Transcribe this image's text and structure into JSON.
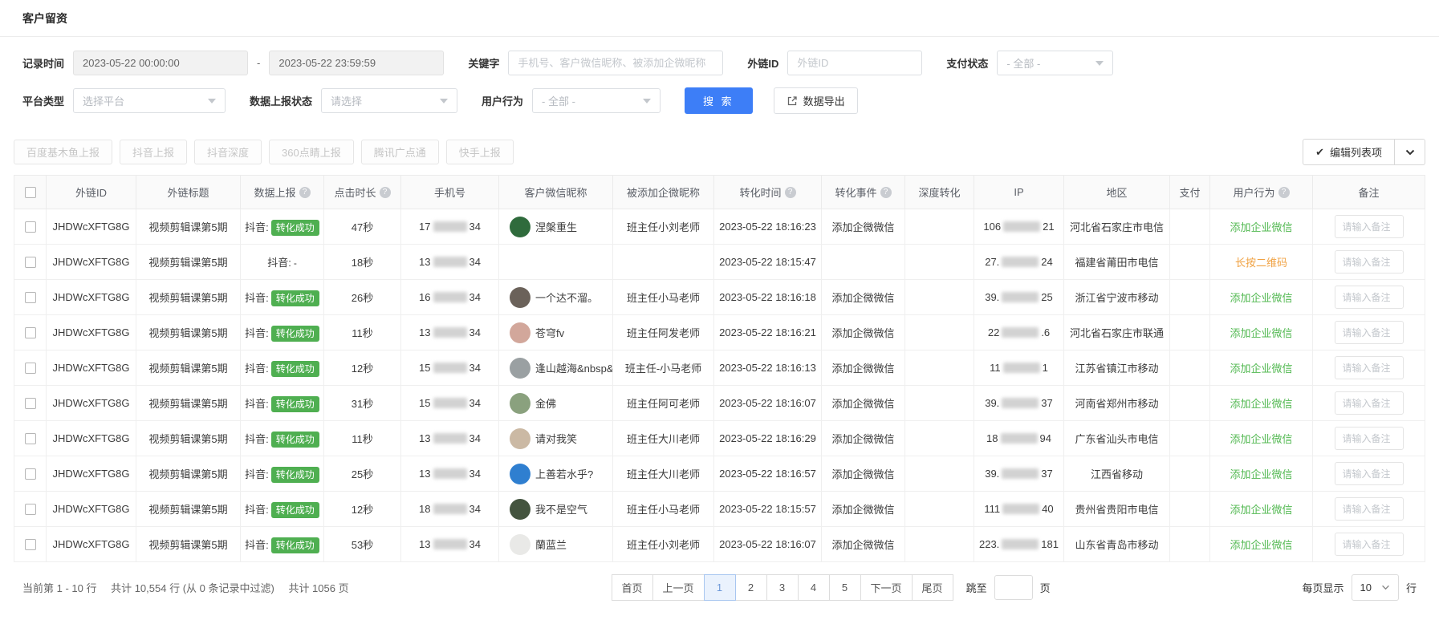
{
  "page": {
    "title": "客户留资"
  },
  "icons": {
    "help_glyph": "?",
    "check_glyph": "✔"
  },
  "colors": {
    "accent_blue": "#3d7ef7",
    "badge_green": "#4faf51",
    "link_green": "#53b952",
    "warn_orange": "#f0a243"
  },
  "filters": {
    "record_time": {
      "label": "记录时间",
      "from": "2023-05-22 00:00:00",
      "separator": "-",
      "to": "2023-05-22 23:59:59"
    },
    "keyword": {
      "label": "关键字",
      "placeholder": "手机号、客户微信昵称、被添加企微昵称"
    },
    "link_id": {
      "label": "外链ID",
      "placeholder": "外链ID"
    },
    "pay_status": {
      "label": "支付状态",
      "value": "- 全部 -"
    },
    "platform": {
      "label": "平台类型",
      "placeholder": "选择平台"
    },
    "report_state": {
      "label": "数据上报状态",
      "placeholder": "请选择"
    },
    "user_behavior": {
      "label": "用户行为",
      "value": "- 全部 -"
    },
    "search_label": "搜 索",
    "export_label": "数据导出"
  },
  "report_tabs": [
    "百度基木鱼上报",
    "抖音上报",
    "抖音深度",
    "360点睛上报",
    "腾讯广点通",
    "快手上报"
  ],
  "edit_columns": {
    "label": "编辑列表项"
  },
  "table": {
    "note_placeholder": "请输入备注",
    "headers": [
      {
        "label": "外链ID",
        "help": false
      },
      {
        "label": "外链标题",
        "help": false
      },
      {
        "label": "数据上报",
        "help": true
      },
      {
        "label": "点击时长",
        "help": true
      },
      {
        "label": "手机号",
        "help": false
      },
      {
        "label": "客户微信昵称",
        "help": false
      },
      {
        "label": "被添加企微昵称",
        "help": false
      },
      {
        "label": "转化时间",
        "help": true
      },
      {
        "label": "转化事件",
        "help": true
      },
      {
        "label": "深度转化",
        "help": false
      },
      {
        "label": "IP",
        "help": false
      },
      {
        "label": "地区",
        "help": false
      },
      {
        "label": "支付",
        "help": false
      },
      {
        "label": "用户行为",
        "help": true
      },
      {
        "label": "备注",
        "help": false
      }
    ],
    "rows": [
      {
        "link_id": "JHDWcXFTG8G",
        "link_title": "视频剪辑课第5期",
        "report_prefix": "抖音:",
        "report_status": "转化成功",
        "report_success": true,
        "duration": "47秒",
        "phone_prefix": "17",
        "phone_suffix": "34",
        "avatar_color": "#2f6b3c",
        "nickname": "涅槃重生",
        "added_name": "班主任小刘老师",
        "convert_time": "2023-05-22 18:16:23",
        "convert_event": "添加企微微信",
        "deep_convert": "",
        "ip_prefix": "106",
        "ip_suffix": "21",
        "region": "河北省石家庄市电信",
        "pay": "",
        "behavior": "添加企业微信",
        "behavior_type": "green"
      },
      {
        "link_id": "JHDWcXFTG8G",
        "link_title": "视频剪辑课第5期",
        "report_prefix": "抖音:",
        "report_status": "-",
        "report_success": false,
        "duration": "18秒",
        "phone_prefix": "13",
        "phone_suffix": "34",
        "avatar_color": "",
        "nickname": "",
        "added_name": "",
        "convert_time": "2023-05-22 18:15:47",
        "convert_event": "",
        "deep_convert": "",
        "ip_prefix": "27.",
        "ip_suffix": "24",
        "region": "福建省莆田市电信",
        "pay": "",
        "behavior": "长按二维码",
        "behavior_type": "orange"
      },
      {
        "link_id": "JHDWcXFTG8G",
        "link_title": "视频剪辑课第5期",
        "report_prefix": "抖音:",
        "report_status": "转化成功",
        "report_success": true,
        "duration": "26秒",
        "phone_prefix": "16",
        "phone_suffix": "34",
        "avatar_color": "#6b625a",
        "nickname": "一个达不溜。",
        "added_name": "班主任小马老师",
        "convert_time": "2023-05-22 18:16:18",
        "convert_event": "添加企微微信",
        "deep_convert": "",
        "ip_prefix": "39.",
        "ip_suffix": "25",
        "region": "浙江省宁波市移动",
        "pay": "",
        "behavior": "添加企业微信",
        "behavior_type": "green"
      },
      {
        "link_id": "JHDWcXFTG8G",
        "link_title": "视频剪辑课第5期",
        "report_prefix": "抖音:",
        "report_status": "转化成功",
        "report_success": true,
        "duration": "11秒",
        "phone_prefix": "13",
        "phone_suffix": "34",
        "avatar_color": "#d2a79b",
        "nickname": "苍穹fv",
        "added_name": "班主任阿发老师",
        "convert_time": "2023-05-22 18:16:21",
        "convert_event": "添加企微微信",
        "deep_convert": "",
        "ip_prefix": "22",
        "ip_suffix": ".6",
        "region": "河北省石家庄市联通",
        "pay": "",
        "behavior": "添加企业微信",
        "behavior_type": "green"
      },
      {
        "link_id": "JHDWcXFTG8G",
        "link_title": "视频剪辑课第5期",
        "report_prefix": "抖音:",
        "report_status": "转化成功",
        "report_success": true,
        "duration": "12秒",
        "phone_prefix": "15",
        "phone_suffix": "34",
        "avatar_color": "#9aa0a2",
        "nickname": "逢山越海&nbsp&nbsp",
        "added_name": "班主任-小马老师",
        "convert_time": "2023-05-22 18:16:13",
        "convert_event": "添加企微微信",
        "deep_convert": "",
        "ip_prefix": "11",
        "ip_suffix": "1",
        "region": "江苏省镇江市移动",
        "pay": "",
        "behavior": "添加企业微信",
        "behavior_type": "green"
      },
      {
        "link_id": "JHDWcXFTG8G",
        "link_title": "视频剪辑课第5期",
        "report_prefix": "抖音:",
        "report_status": "转化成功",
        "report_success": true,
        "duration": "31秒",
        "phone_prefix": "15",
        "phone_suffix": "34",
        "avatar_color": "#8aa17e",
        "nickname": "金佛",
        "added_name": "班主任阿可老师",
        "convert_time": "2023-05-22 18:16:07",
        "convert_event": "添加企微微信",
        "deep_convert": "",
        "ip_prefix": "39.",
        "ip_suffix": "37",
        "region": "河南省郑州市移动",
        "pay": "",
        "behavior": "添加企业微信",
        "behavior_type": "green"
      },
      {
        "link_id": "JHDWcXFTG8G",
        "link_title": "视频剪辑课第5期",
        "report_prefix": "抖音:",
        "report_status": "转化成功",
        "report_success": true,
        "duration": "11秒",
        "phone_prefix": "13",
        "phone_suffix": "34",
        "avatar_color": "#cbb9a4",
        "nickname": "请对我笑",
        "added_name": "班主任大川老师",
        "convert_time": "2023-05-22 18:16:29",
        "convert_event": "添加企微微信",
        "deep_convert": "",
        "ip_prefix": "18",
        "ip_suffix": "94",
        "region": "广东省汕头市电信",
        "pay": "",
        "behavior": "添加企业微信",
        "behavior_type": "green"
      },
      {
        "link_id": "JHDWcXFTG8G",
        "link_title": "视频剪辑课第5期",
        "report_prefix": "抖音:",
        "report_status": "转化成功",
        "report_success": true,
        "duration": "25秒",
        "phone_prefix": "13",
        "phone_suffix": "34",
        "avatar_color": "#2f7fd0",
        "nickname": "上善若水乎?",
        "added_name": "班主任大川老师",
        "convert_time": "2023-05-22 18:16:57",
        "convert_event": "添加企微微信",
        "deep_convert": "",
        "ip_prefix": "39.",
        "ip_suffix": "37",
        "region": "江西省移动",
        "pay": "",
        "behavior": "添加企业微信",
        "behavior_type": "green"
      },
      {
        "link_id": "JHDWcXFTG8G",
        "link_title": "视频剪辑课第5期",
        "report_prefix": "抖音:",
        "report_status": "转化成功",
        "report_success": true,
        "duration": "12秒",
        "phone_prefix": "18",
        "phone_suffix": "34",
        "avatar_color": "#44543f",
        "nickname": "我不是空气",
        "added_name": "班主任小马老师",
        "convert_time": "2023-05-22 18:15:57",
        "convert_event": "添加企微微信",
        "deep_convert": "",
        "ip_prefix": "111",
        "ip_suffix": "40",
        "region": "贵州省贵阳市电信",
        "pay": "",
        "behavior": "添加企业微信",
        "behavior_type": "green"
      },
      {
        "link_id": "JHDWcXFTG8G",
        "link_title": "视频剪辑课第5期",
        "report_prefix": "抖音:",
        "report_status": "转化成功",
        "report_success": true,
        "duration": "53秒",
        "phone_prefix": "13",
        "phone_suffix": "34",
        "avatar_color": "#e9e9e7",
        "nickname": "蘭蓝兰",
        "added_name": "班主任小刘老师",
        "convert_time": "2023-05-22 18:16:07",
        "convert_event": "添加企微微信",
        "deep_convert": "",
        "ip_prefix": "223.",
        "ip_suffix": "181",
        "region": "山东省青岛市移动",
        "pay": "",
        "behavior": "添加企业微信",
        "behavior_type": "green"
      }
    ]
  },
  "footer": {
    "info_parts": [
      "当前第 1 - 10 行",
      "共计 10,554 行 (从 0 条记录中过滤)",
      "共计 1056 页"
    ],
    "pagination": {
      "first": "首页",
      "prev": "上一页",
      "pages": [
        "1",
        "2",
        "3",
        "4",
        "5"
      ],
      "active": "1",
      "next": "下一页",
      "last": "尾页",
      "jump_label": "跳至",
      "jump_unit": "页"
    },
    "page_size": {
      "label": "每页显示",
      "value": "10",
      "unit": "行"
    }
  }
}
